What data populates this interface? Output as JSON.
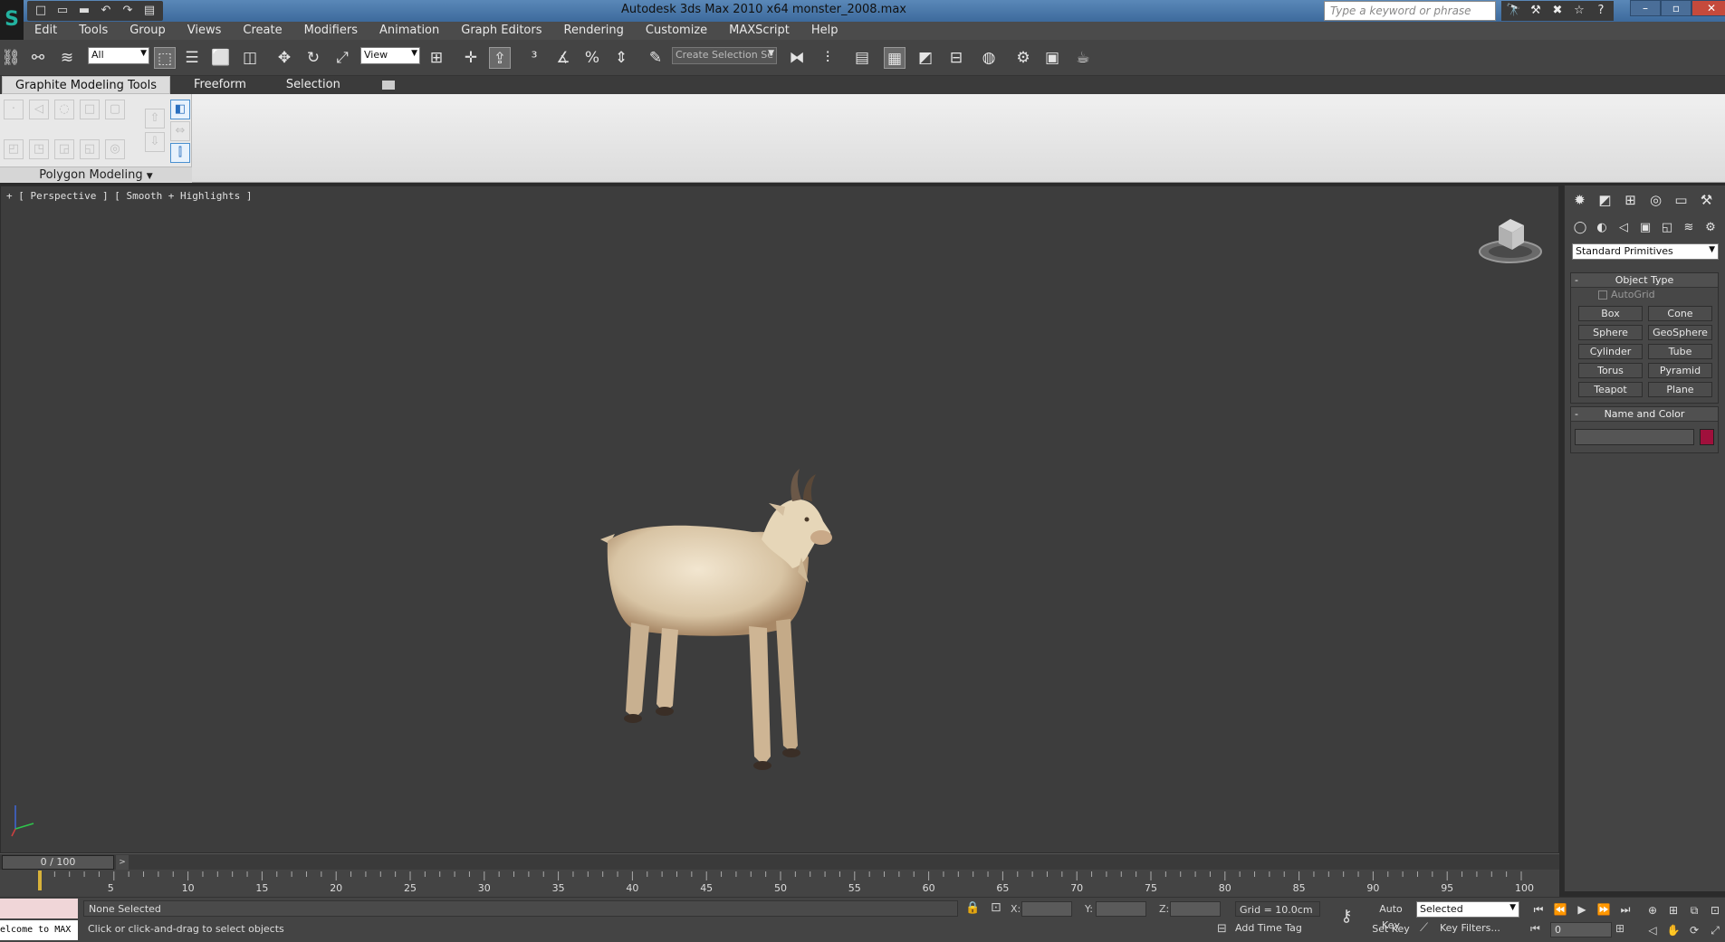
{
  "window": {
    "title": "Autodesk 3ds Max  2010 x64     monster_2008.max",
    "search_placeholder": "Type a keyword or phrase",
    "controls": [
      "–",
      "▫",
      "✕"
    ]
  },
  "quick_access": [
    "□",
    "▭",
    "▬",
    "↶",
    "↷",
    "▤"
  ],
  "search_tools": [
    "🔭",
    "⚒",
    "✖",
    "☆",
    "?"
  ],
  "app_logo": "S",
  "menu": [
    "Edit",
    "Tools",
    "Group",
    "Views",
    "Create",
    "Modifiers",
    "Animation",
    "Graph Editors",
    "Rendering",
    "Customize",
    "MAXScript",
    "Help"
  ],
  "toolbar": {
    "selection_filter": "All",
    "reference_coord": "View",
    "named_selection_placeholder": "Create Selection Se"
  },
  "ribbon": {
    "tabs": [
      "Graphite Modeling Tools",
      "Freeform",
      "Selection"
    ],
    "panel_label": "Polygon Modeling"
  },
  "viewport": {
    "label": "+ [ Perspective ] [ Smooth + Highlights ]"
  },
  "command_panel": {
    "category": "Standard Primitives",
    "object_type_title": "Object Type",
    "autogrid_label": "AutoGrid",
    "primitives": [
      "Box",
      "Cone",
      "Sphere",
      "GeoSphere",
      "Cylinder",
      "Tube",
      "Torus",
      "Pyramid",
      "Teapot",
      "Plane"
    ],
    "name_color_title": "Name and Color",
    "object_color": "#a0103c"
  },
  "timeline": {
    "current": "0 / 100",
    "ticks": [
      5,
      10,
      15,
      20,
      25,
      30,
      35,
      40,
      45,
      50,
      55,
      60,
      65,
      70,
      75,
      80,
      85,
      90,
      95,
      100
    ],
    "max_frame": 100
  },
  "status": {
    "maxscript_text": "elcome to MAX",
    "selection": "None Selected",
    "prompt": "Click or click-and-drag to select objects",
    "coord_x_label": "X:",
    "coord_y_label": "Y:",
    "coord_z_label": "Z:",
    "grid": "Grid = 10.0cm",
    "add_time_tag": "Add Time Tag",
    "auto_key": "Auto Key",
    "set_key": "Set Key",
    "key_mode": "Selected",
    "key_filters": "Key Filters...",
    "frame": "0"
  }
}
